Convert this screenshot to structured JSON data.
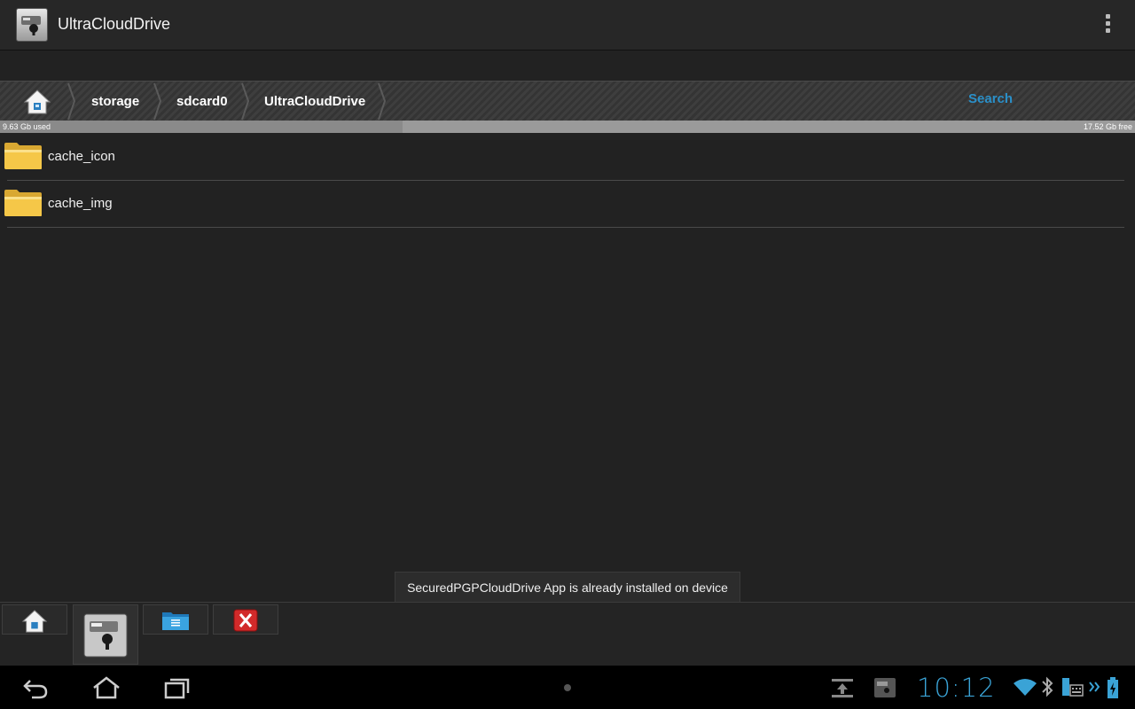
{
  "actionbar": {
    "title": "UltraCloudDrive",
    "app_icon": "keyhole-drive-icon",
    "menu_icon": "overflow-menu-icon"
  },
  "breadcrumb": {
    "home_icon": "home-icon",
    "items": [
      "storage",
      "sdcard0",
      "UltraCloudDrive"
    ],
    "search_label": "Search"
  },
  "storage": {
    "used_label": "9.63 Gb used",
    "free_label": "17.52 Gb free",
    "used_fraction": 0.355
  },
  "files": [
    {
      "name": "cache_icon",
      "icon": "folder-icon"
    },
    {
      "name": "cache_img",
      "icon": "folder-icon"
    }
  ],
  "toast": {
    "message": "SecuredPGPCloudDrive App is already installed on device"
  },
  "toolbar": {
    "buttons": [
      {
        "icon": "home-icon",
        "active": false
      },
      {
        "icon": "keyhole-drive-icon",
        "active": true
      },
      {
        "icon": "folder-info-icon",
        "active": false
      },
      {
        "icon": "close-icon",
        "active": false
      }
    ]
  },
  "systembar": {
    "clock": "10:12",
    "icons": [
      "back-icon",
      "home-icon",
      "recent-apps-icon",
      "download-icon",
      "app-icon",
      "wifi-icon",
      "bluetooth-icon",
      "keyboard-icon",
      "chevron-icon",
      "battery-icon"
    ],
    "accent": "#3aa3d6"
  }
}
